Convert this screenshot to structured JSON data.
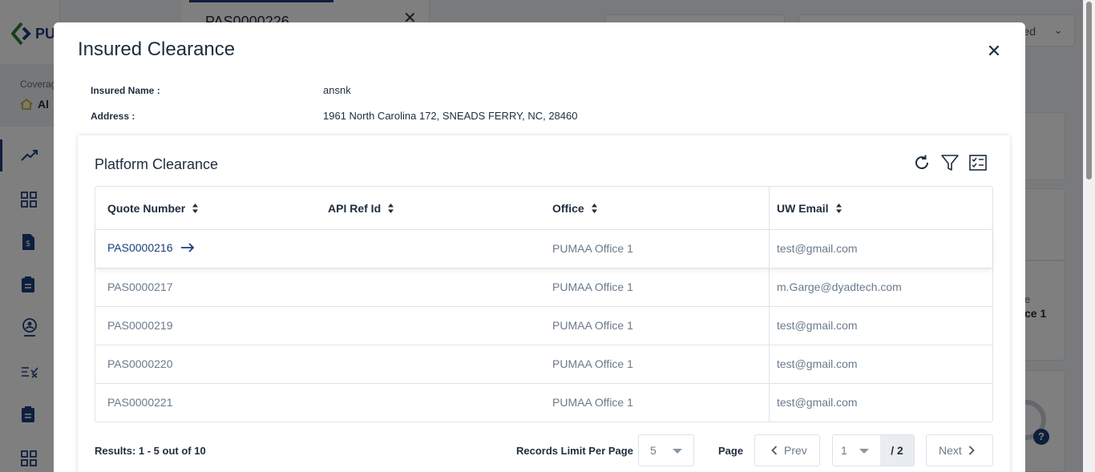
{
  "background": {
    "logo_text": "PU",
    "coverage_label": "Coverag",
    "coverage_value": "Al",
    "tab_label": "PAS0000226",
    "field_value": "ured",
    "card_label": "e",
    "card_value": "ce 1",
    "help_label": "?"
  },
  "modal": {
    "title": "Insured Clearance",
    "insured_name_label": "Insured Name :",
    "insured_name_value": "ansnk",
    "address_label": "Address :",
    "address_value": "1961 North Carolina 172, SNEADS FERRY, NC, 28460"
  },
  "panel": {
    "title": "Platform Clearance",
    "tools": [
      "refresh-icon",
      "filter-icon",
      "checklist-icon"
    ]
  },
  "table": {
    "columns": [
      {
        "label": "Quote Number"
      },
      {
        "label": "API Ref Id"
      },
      {
        "label": "Office"
      },
      {
        "label": "UW Email"
      }
    ],
    "rows": [
      {
        "quote": "PAS0000216",
        "api_ref": "",
        "office": "PUMAA Office 1",
        "email": "test@gmail.com"
      },
      {
        "quote": "PAS0000217",
        "api_ref": "",
        "office": "PUMAA Office 1",
        "email": "m.Garge@dyadtech.com"
      },
      {
        "quote": "PAS0000219",
        "api_ref": "",
        "office": "PUMAA Office 1",
        "email": "test@gmail.com"
      },
      {
        "quote": "PAS0000220",
        "api_ref": "",
        "office": "PUMAA Office 1",
        "email": "test@gmail.com"
      },
      {
        "quote": "PAS0000221",
        "api_ref": "",
        "office": "PUMAA Office 1",
        "email": "test@gmail.com"
      }
    ]
  },
  "footer": {
    "results_text": "Results: 1 - 5 out of 10",
    "limit_label": "Records Limit Per Page",
    "limit_value": "5",
    "page_label": "Page",
    "prev_label": "Prev",
    "page_value": "1",
    "total_pages": "/ 2",
    "next_label": "Next"
  },
  "colors": {
    "primary": "#1c3f7a",
    "muted_text": "#6b7a8c",
    "overlay": "rgba(0,0,0,0.5)"
  }
}
